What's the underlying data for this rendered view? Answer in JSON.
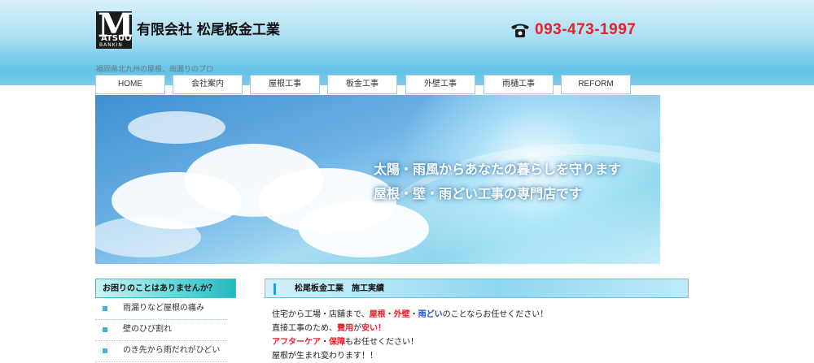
{
  "header": {
    "logo": {
      "mark": "M",
      "sub1": "ATSUO",
      "sub2": "BANKIN"
    },
    "company_name": "有限会社 松尾板金工業",
    "phone": "093-473-1997",
    "tagline": "福岡県北九州の屋根、雨漏りのプロ"
  },
  "nav": {
    "items": [
      {
        "label": "HOME"
      },
      {
        "label": "会社案内"
      },
      {
        "label": "屋根工事"
      },
      {
        "label": "板金工事"
      },
      {
        "label": "外壁工事"
      },
      {
        "label": "雨樋工事"
      },
      {
        "label": "REFORM"
      }
    ]
  },
  "hero": {
    "line1": "太陽・雨風からあなたの暮らしを守ります",
    "line2": "屋根・壁・雨どい工事の専門店です"
  },
  "sidebar": {
    "heading": "お困りのことはありませんか？",
    "items": [
      {
        "label": "雨漏りなど屋根の痛み"
      },
      {
        "label": "壁のひび割れ"
      },
      {
        "label": "のき先から雨だれがひどい"
      }
    ]
  },
  "content": {
    "heading": "松尾板金工業　施工実績",
    "p1": {
      "a": "住宅から工場・店舗まで、",
      "roof": "屋根",
      "sep1": "・",
      "wall": "外壁",
      "sep2": "・",
      "gutter": "雨どい",
      "b": "のことならお任せください！"
    },
    "p2": {
      "a": "直接工事のため、",
      "cost": "費用",
      "b": "が",
      "cheap": "安い！"
    },
    "p3": {
      "aftercare": "アフターケア",
      "sep": "・",
      "warranty": "保障",
      "b": "もお任せください！"
    },
    "p4": "屋根が生まれ変わります！！"
  },
  "colors": {
    "accent_red": "#e8202a",
    "accent_blue": "#1d4fc7",
    "header_cyan": "#3bb1de",
    "side_teal": "#21b8bf"
  }
}
